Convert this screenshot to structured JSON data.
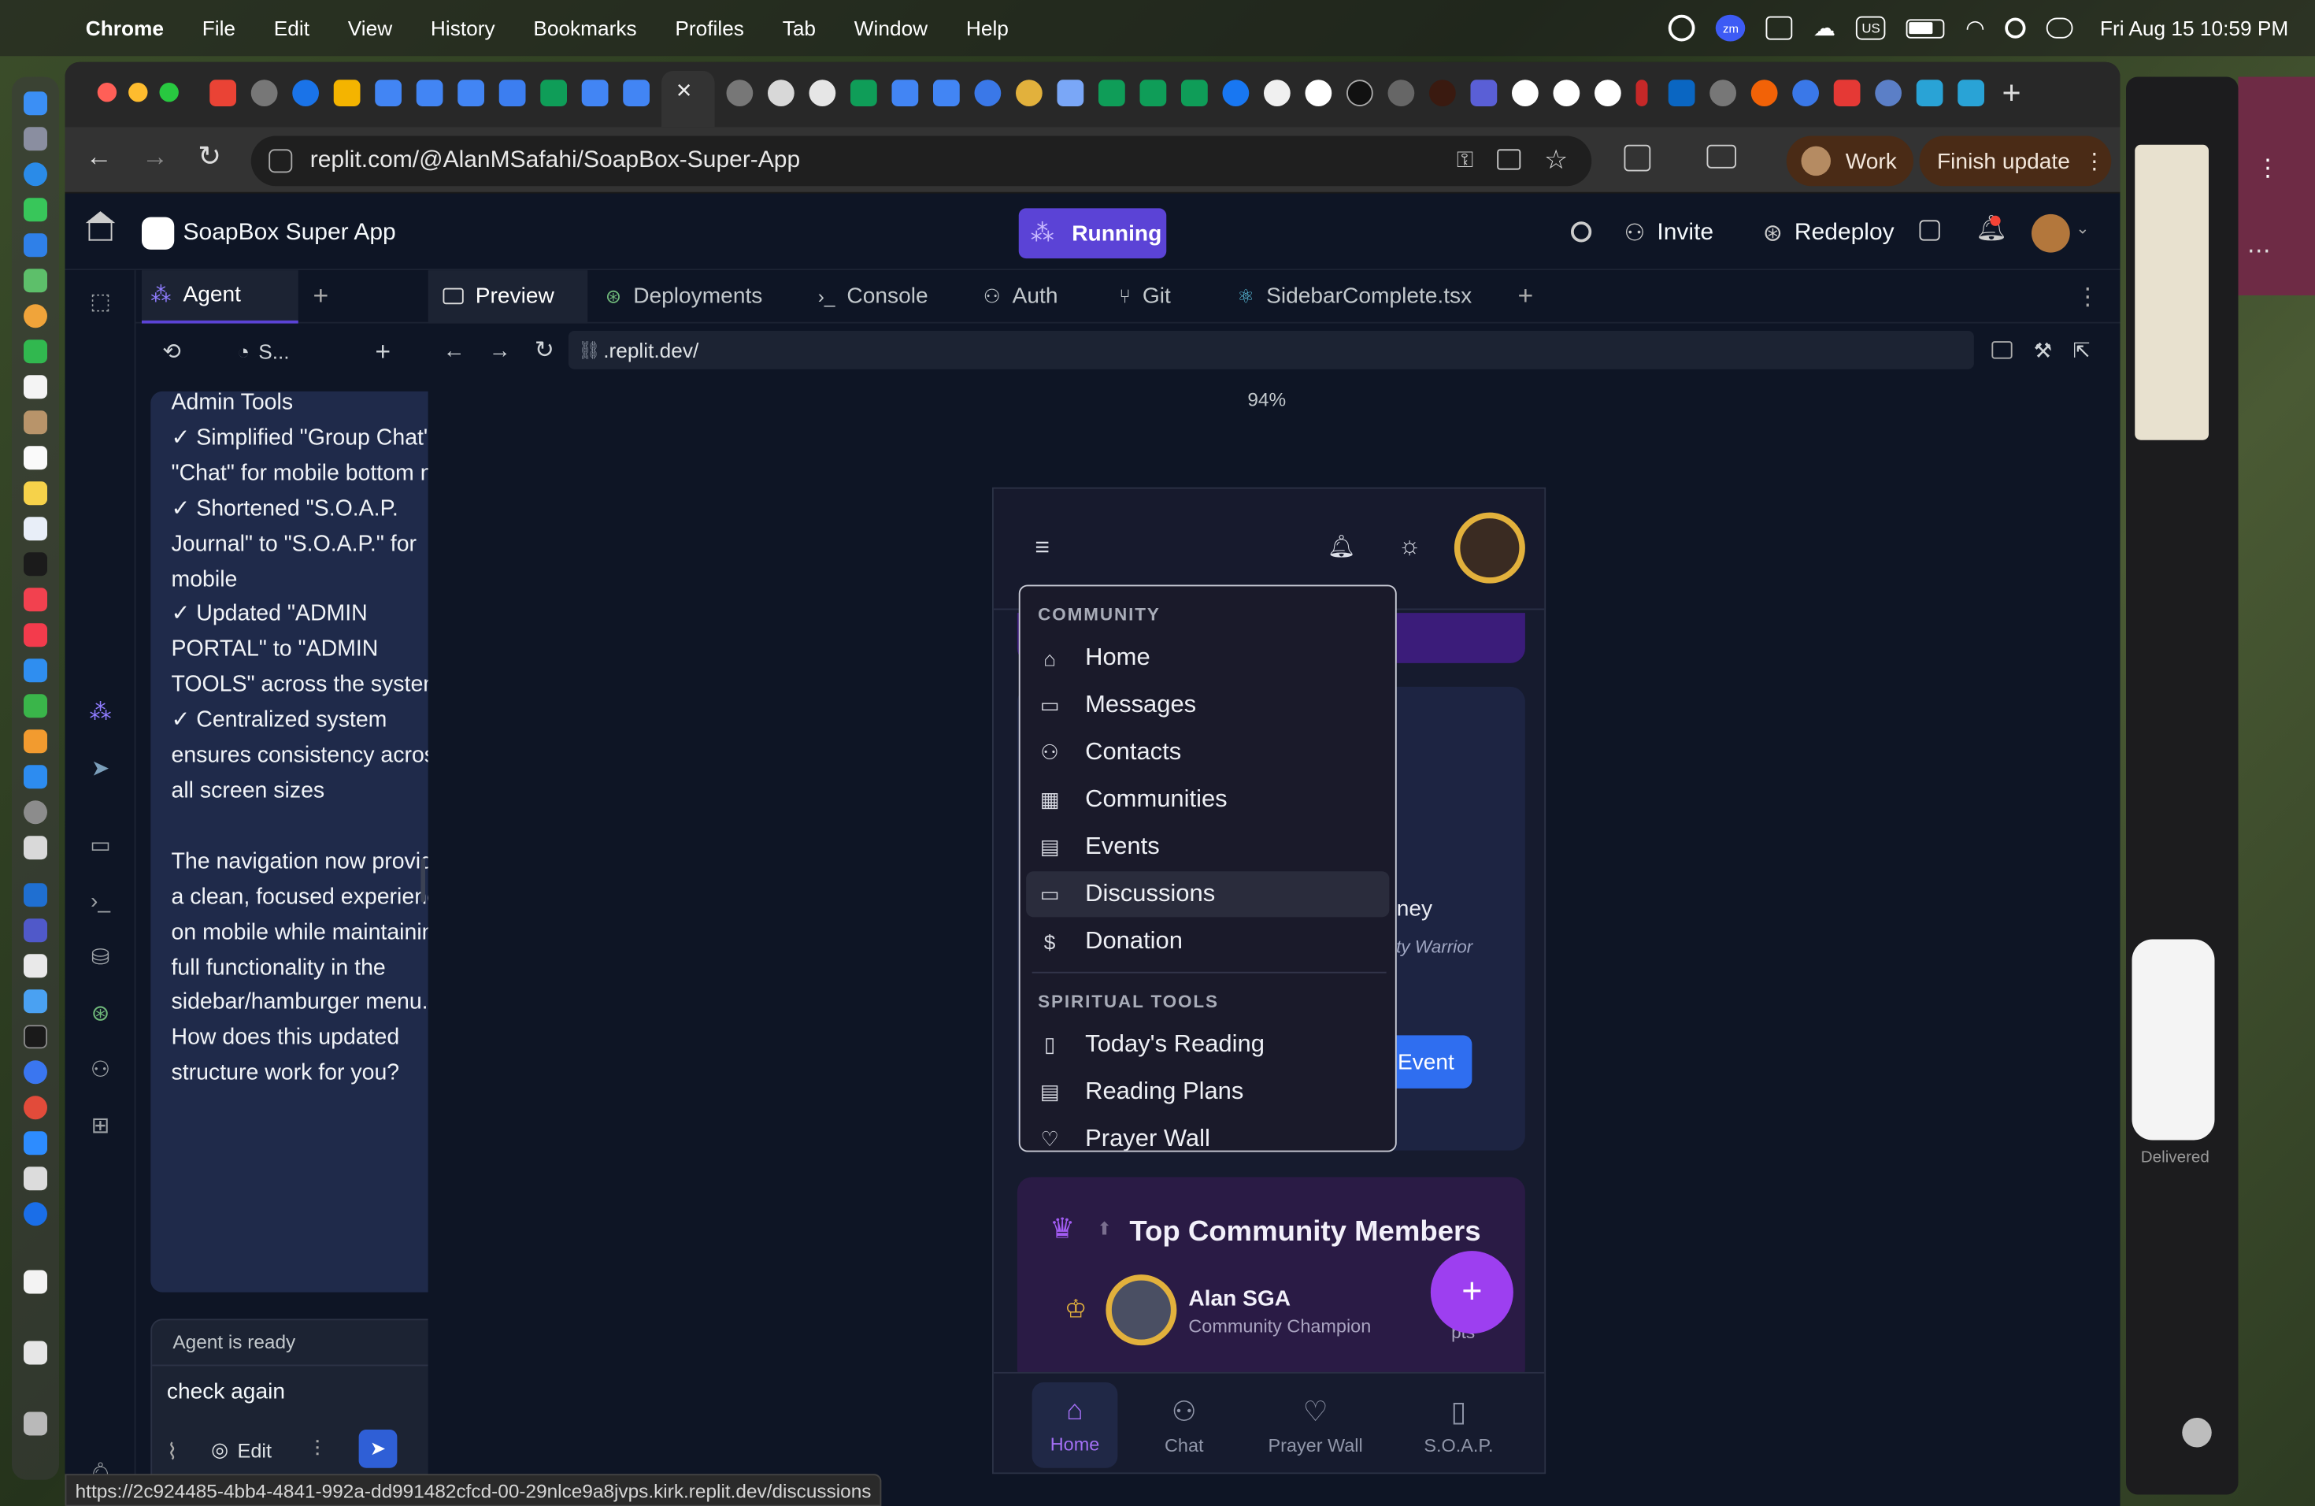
{
  "menubar": {
    "app": "Chrome",
    "items": [
      "File",
      "Edit",
      "View",
      "History",
      "Bookmarks",
      "Profiles",
      "Tab",
      "Window",
      "Help"
    ],
    "datetime": "Fri Aug 15  10:59 PM",
    "input_source": "US"
  },
  "browser": {
    "url": "replit.com/@AlanMSafahi/SoapBox-Super-App",
    "profile_label": "Work",
    "finish_update_label": "Finish update",
    "status_url": "https://2c924485-4bb4-4841-992a-dd991482cfcd-00-29nlce9a8jvps.kirk.replit.dev/discussions"
  },
  "replit": {
    "project_name": "SoapBox Super App",
    "run_status": "Running",
    "invite_label": "Invite",
    "redeploy_label": "Redeploy",
    "left_tabs": {
      "agent": "Agent",
      "add": "+"
    },
    "left_subtab": "S...",
    "main_tabs": [
      "Preview",
      "Deployments",
      "Console",
      "Auth",
      "Git",
      "SidebarComplete.tsx"
    ],
    "preview_url": ".replit.dev/",
    "zoom": "94%",
    "chat_message": "Admin Tools\n✓ Simplified \"Group Chat\" to \"Chat\" for mobile bottom nav\n✓ Shortened \"S.O.A.P. Journal\" to \"S.O.A.P.\" for mobile\n✓ Updated \"ADMIN PORTAL\" to \"ADMIN TOOLS\" across the system\n✓ Centralized system ensures consistency across all screen sizes\n\nThe navigation now provides a clean, focused experience on mobile while maintaining full functionality in the sidebar/hamburger menu. How does this updated structure work for you?",
    "agent_status": "Agent is ready",
    "chat_input_value": "check again",
    "edit_label": "Edit"
  },
  "app": {
    "menu": {
      "section_community": "COMMUNITY",
      "community_items": [
        "Home",
        "Messages",
        "Contacts",
        "Communities",
        "Events",
        "Discussions",
        "Donation"
      ],
      "active_item": "Discussions",
      "section_spiritual": "SPIRITUAL TOOLS",
      "spiritual_items": [
        "Today's Reading",
        "Reading Plans",
        "Prayer Wall"
      ]
    },
    "card_partial_text": "rney",
    "card_partial_sub": "nty Warrior",
    "event_button_partial": "Event",
    "top_members_title": "Top Community Members",
    "member_name": "Alan SGA",
    "member_role": "Community Champion",
    "member_points_partial": "pts",
    "bottom_nav": [
      "Home",
      "Chat",
      "Prayer Wall",
      "S.O.A.P."
    ]
  },
  "background_app": {
    "delivered_label": "Delivered"
  },
  "colors": {
    "replit_bg": "#0e1525",
    "running_pill": "#5b43d6",
    "accent_purple": "#8b3fe0",
    "gold": "#e2b13c",
    "finish_update_bg": "#4a2b16"
  }
}
